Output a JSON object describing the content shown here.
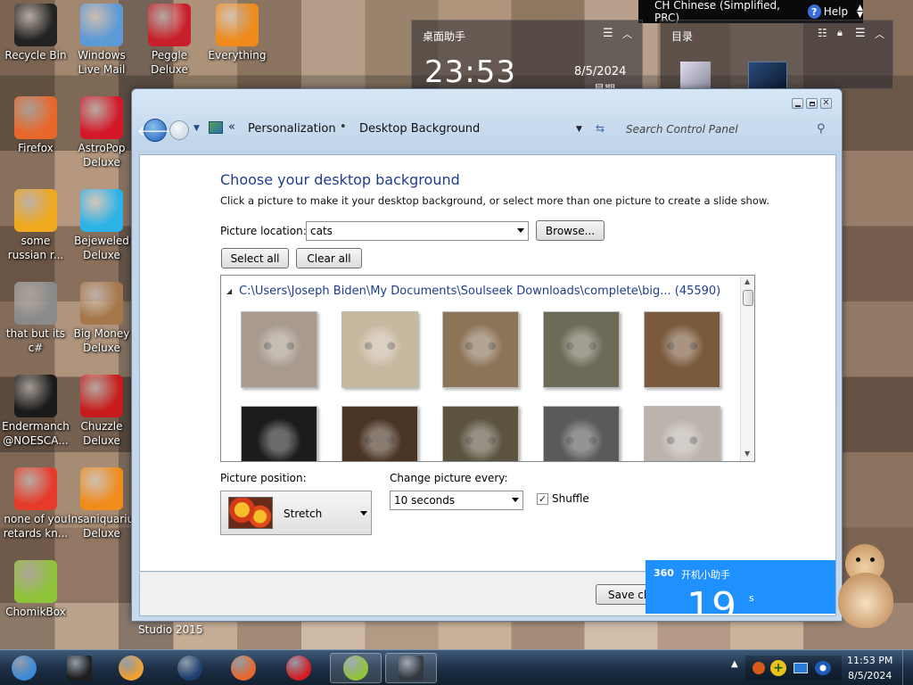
{
  "desktop_icons": [
    {
      "label": "Recycle Bin",
      "icon": "recycle-bin-icon",
      "color": "#222222"
    },
    {
      "label": "Windows Live Mail",
      "icon": "mail-icon",
      "color": "#5c9ad6"
    },
    {
      "label": "Peggle Deluxe",
      "icon": "peggle-icon",
      "color": "#c8202a"
    },
    {
      "label": "Everything",
      "icon": "search-magnifier-icon",
      "color": "#f08a1c"
    },
    {
      "label": "Firefox",
      "icon": "firefox-icon",
      "color": "#e8672a"
    },
    {
      "label": "AstroPop Deluxe",
      "icon": "astropop-icon",
      "color": "#d4182a"
    },
    {
      "label": "some russian r...",
      "icon": "de-icon",
      "color": "#f0a81c"
    },
    {
      "label": "Bejeweled Deluxe",
      "icon": "gem-icon",
      "color": "#2bb3e8"
    },
    {
      "label": "that but its c#",
      "icon": "stack-icon",
      "color": "#8a8a8a"
    },
    {
      "label": "Big Money Deluxe",
      "icon": "money-bag-icon",
      "color": "#a5774a"
    },
    {
      "label": "Endermanch @NOESCA...",
      "icon": "terminal-icon",
      "color": "#1a1a1a"
    },
    {
      "label": "Chuzzle Deluxe",
      "icon": "chuzzle-icon",
      "color": "#c81c1c"
    },
    {
      "label": "none of you retards kn...",
      "icon": "dino-icon",
      "color": "#e63a2a"
    },
    {
      "label": "Insaniquarium Deluxe",
      "icon": "fish-icon",
      "color": "#f08c1c"
    },
    {
      "label": "ChomikBox",
      "icon": "hamster-box-icon",
      "color": "#8fc43a"
    }
  ],
  "lang_bar": {
    "language": "CH Chinese (Simplified, PRC)",
    "help": "Help"
  },
  "clock_widget": {
    "title": "桌面助手",
    "time": "23:53",
    "date": "8/5/2024",
    "weekday": "星期"
  },
  "dir_widget": {
    "title": "目录"
  },
  "window": {
    "breadcrumb": [
      "Personalization",
      "Desktop Background"
    ],
    "search_placeholder": "Search Control Panel",
    "heading": "Choose your desktop background",
    "subtitle": "Click a picture to make it your desktop background, or select more than one picture to create a slide show.",
    "picture_location_label": "Picture location:",
    "picture_location_value": "cats",
    "browse": "Browse...",
    "select_all": "Select all",
    "clear_all": "Clear all",
    "folder_path": "C:\\Users\\Joseph Biden\\My Documents\\Soulseek Downloads\\complete\\big... (45590)",
    "thumbnails": [
      {
        "name": "cat-1",
        "color": "#a89a8e"
      },
      {
        "name": "cat-2",
        "color": "#c8b8a0"
      },
      {
        "name": "cat-3",
        "color": "#8c7458"
      },
      {
        "name": "cat-4",
        "color": "#6e6a58"
      },
      {
        "name": "cat-5",
        "color": "#7a5a3c"
      },
      {
        "name": "cat-6",
        "color": "#1c1c1c"
      },
      {
        "name": "cat-7",
        "color": "#4a3424"
      },
      {
        "name": "cat-8",
        "color": "#5c5440"
      },
      {
        "name": "cat-9",
        "color": "#5a5a5a"
      },
      {
        "name": "cat-10",
        "color": "#bcb4ac"
      }
    ],
    "picture_position_label": "Picture position:",
    "picture_position_value": "Stretch",
    "change_every_label": "Change picture every:",
    "change_every_value": "10 seconds",
    "shuffle_label": "Shuffle",
    "save_button": "Save changes"
  },
  "popup_360": {
    "brand": "360",
    "title": "开机小助手",
    "value": "19",
    "unit": "s"
  },
  "taskbar_label": "Studio 2015",
  "tray": {
    "time": "11:53 PM",
    "date": "8/5/2024"
  },
  "taskbar_items": [
    {
      "icon": "start-orb-icon",
      "color": "#3b8ad8"
    },
    {
      "icon": "dark-box-icon",
      "color": "#1e1e1e"
    },
    {
      "icon": "media-player-icon",
      "color": "#f0a030"
    },
    {
      "icon": "globe-icon",
      "color": "#1c3f70"
    },
    {
      "icon": "firefox-taskbar-icon",
      "color": "#e8672a"
    },
    {
      "icon": "wps-icon",
      "color": "#d81c24"
    },
    {
      "icon": "chomikbox-taskbar-icon",
      "color": "#8fc43a"
    },
    {
      "icon": "monitor-icon",
      "color": "#333840"
    }
  ],
  "colors": {
    "heading_blue": "#1e3d8c",
    "popup_blue": "#1e90ff"
  }
}
